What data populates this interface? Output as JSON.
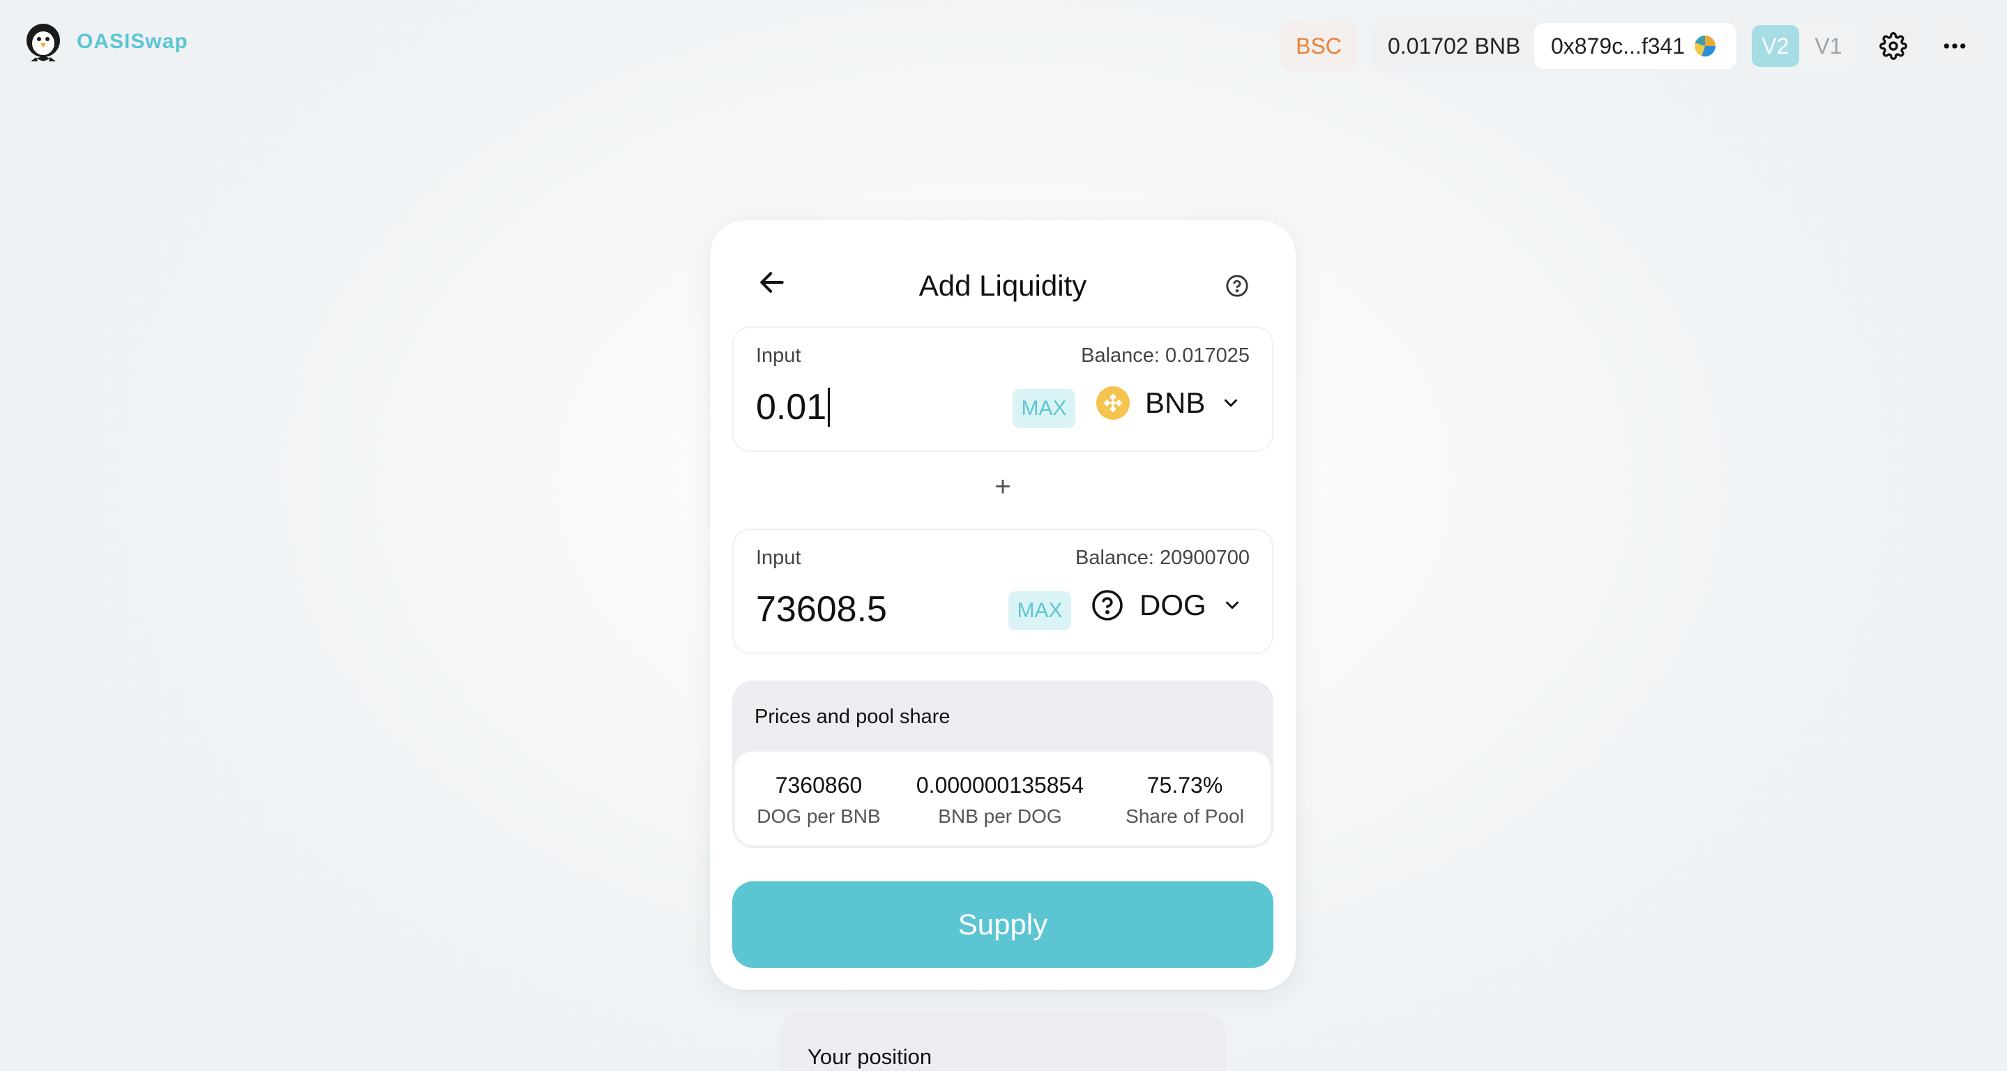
{
  "app": {
    "name": "OASISwap"
  },
  "header": {
    "network": "BSC",
    "native_balance": "0.01702 BNB",
    "address": "0x879c...f341",
    "versions": [
      "V2",
      "V1"
    ],
    "active_version": "V2"
  },
  "card": {
    "title": "Add Liquidity",
    "input_a": {
      "label": "Input",
      "balance": "Balance: 0.017025",
      "amount": "0.01",
      "max_label": "MAX",
      "token": "BNB",
      "token_icon": "bnb-logo-icon"
    },
    "plus": "+",
    "input_b": {
      "label": "Input",
      "balance": "Balance: 20900700",
      "amount": "73608.5",
      "max_label": "MAX",
      "token": "DOG",
      "token_icon": "unknown-token-icon"
    },
    "pool": {
      "title": "Prices and pool share",
      "stats": [
        {
          "value": "7360860",
          "label": "DOG per BNB"
        },
        {
          "value": "0.000000135854",
          "label": "BNB per DOG"
        },
        {
          "value": "75.73%",
          "label": "Share of Pool"
        }
      ]
    },
    "supply_label": "Supply"
  },
  "position": {
    "title": "Your position"
  },
  "colors": {
    "accent": "#5cc5d2",
    "accent_light": "#daf3f5",
    "network": "#e8843c",
    "bnb": "#f0b90b"
  }
}
